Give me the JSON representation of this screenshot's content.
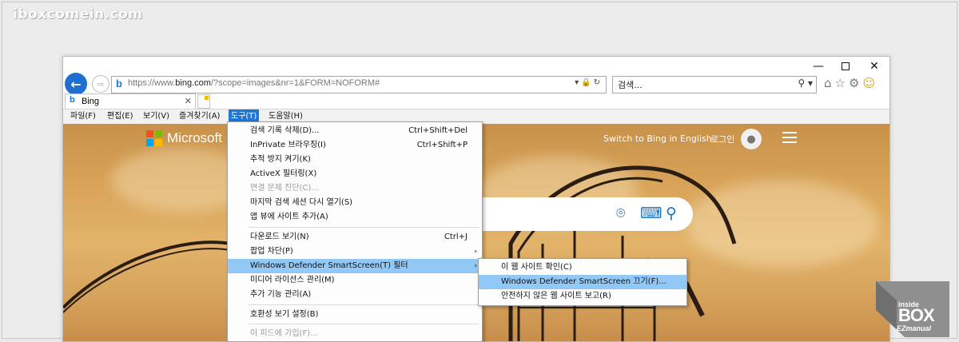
{
  "watermark": "iboxcomein.com",
  "window": {
    "minimize": "—",
    "maximize": "",
    "close": "✕"
  },
  "nav": {
    "back": "←",
    "forward": "⇨"
  },
  "address": {
    "favicon": "b",
    "url_prefix": "https://www.",
    "url_main": "bing.com",
    "url_rest": "/?scope=images&nr=1&FORM=NOFORM#",
    "icons": "▾🔒↻"
  },
  "search": {
    "placeholder": "검색...",
    "icons": "⚲ ▾"
  },
  "toolbar_icons": {
    "home": "⌂",
    "favorites": "☆",
    "settings": "⚙",
    "smiley": "☺"
  },
  "tab": {
    "favicon": "b",
    "title": "Bing",
    "close": "✕"
  },
  "menubar": [
    "파일(F)",
    "편집(E)",
    "보기(V)",
    "즐겨찾기(A)",
    "도구(T)",
    "도움말(H)"
  ],
  "page": {
    "brand": "Microsoft Bing",
    "switch_language": "Switch to Bing in English",
    "login": "로그인",
    "avatar_icon": "user-icon",
    "search_icons": [
      "visual-search-icon",
      "keyboard-icon",
      "search-icon"
    ]
  },
  "tools_menu": [
    {
      "label": "검색 기록 삭제(D)...",
      "shortcut": "Ctrl+Shift+Del"
    },
    {
      "label": "InPrivate 브라우징(I)",
      "shortcut": "Ctrl+Shift+P"
    },
    {
      "label": "추적 방지 켜기(K)",
      "shortcut": ""
    },
    {
      "label": "ActiveX 필터링(X)",
      "shortcut": ""
    },
    {
      "label": "연결 문제 진단(C)...",
      "shortcut": "",
      "disabled": true
    },
    {
      "label": "마지막 검색 세션 다시 열기(S)",
      "shortcut": ""
    },
    {
      "label": "앱 뷰에 사이트 추가(A)",
      "shortcut": ""
    },
    {
      "label": "다운로드 보기(N)",
      "shortcut": "Ctrl+J"
    },
    {
      "label": "팝업 차단(P)",
      "shortcut": "",
      "submenu": true
    },
    {
      "label": "Windows Defender SmartScreen(T) 필터",
      "shortcut": "",
      "submenu": true,
      "highlight": true
    },
    {
      "label": "미디어 라이선스 관리(M)",
      "shortcut": ""
    },
    {
      "label": "추가 기능 관리(A)",
      "shortcut": ""
    },
    {
      "label": "호환성 보기 설정(B)",
      "shortcut": ""
    },
    {
      "label": "이 피드에 가입(F)...",
      "shortcut": "",
      "disabled": true
    }
  ],
  "submenu_arrow": "›",
  "smartscreen_menu": [
    {
      "label": "이 웹 사이트 확인(C)"
    },
    {
      "label": "Windows Defender SmartScreen 끄기(F)...",
      "highlight": true
    },
    {
      "label": "안전하지 않은 웹 사이트 보고(R)"
    }
  ],
  "badge": {
    "line1": "inside",
    "line2": "BOX",
    "line3": "EZmanual"
  },
  "colors": {
    "accent": "#1e76d8",
    "menu_highlight": "#91c8f6",
    "page_sky": "#d9a55a"
  }
}
